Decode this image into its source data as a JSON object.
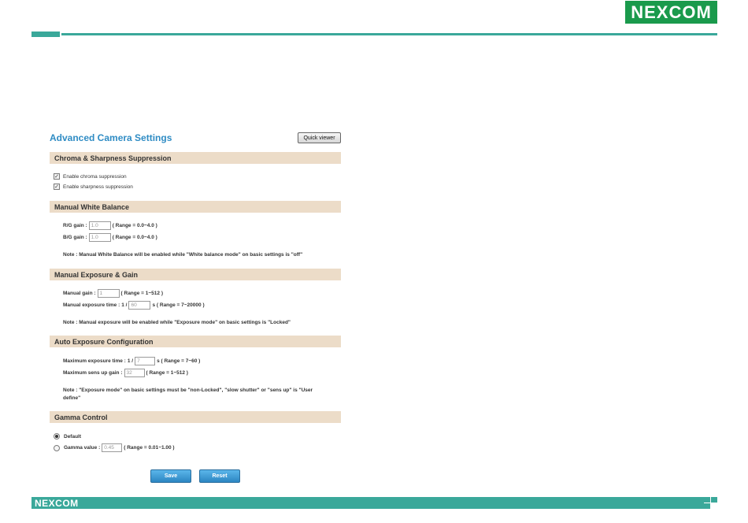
{
  "header": {
    "brand": "NEXCOM"
  },
  "page": {
    "title": "Advanced Camera Settings",
    "quick_viewer": "Quick viewer"
  },
  "chroma": {
    "title": "Chroma & Sharpness Suppression",
    "chroma_label": "Enable chroma suppression",
    "sharpness_label": "Enable sharpness suppression"
  },
  "wb": {
    "title": "Manual White Balance",
    "rg_label": "R/G gain :",
    "rg_value": "1.0",
    "rg_range": "( Range = 0.0~4.0 )",
    "bg_label": "B/G gain :",
    "bg_value": "1.0",
    "bg_range": "( Range = 0.0~4.0 )",
    "note": "Note : Manual White Balance will be enabled while \"White balance mode\" on basic settings is \"off\""
  },
  "exposure": {
    "title": "Manual Exposure & Gain",
    "gain_label": "Manual gain :",
    "gain_value": "1",
    "gain_range": "( Range = 1~512 )",
    "time_label": "Manual exposure time :",
    "time_prefix": "1 /",
    "time_value": "60",
    "time_range": "s ( Range = 7~20000 )",
    "note": "Note : Manual exposure will be enabled while \"Exposure mode\" on basic settings is \"Locked\""
  },
  "auto": {
    "title": "Auto Exposure Configuration",
    "max_time_label": "Maximum exposure time :",
    "max_time_prefix": "1 /",
    "max_time_value": "7",
    "max_time_range": "s ( Range = 7~60 )",
    "sens_label": "Maximum sens up gain :",
    "sens_value": "32",
    "sens_range": "( Range = 1~512 )",
    "note_line1": "Note : \"Exposure mode\" on basic settings must be \"non-Locked\", \"slow shutter\" or \"sens up\" is \"User",
    "note_line2": "define\""
  },
  "gamma": {
    "title": "Gamma Control",
    "default_label": "Default",
    "value_label": "Gamma value :",
    "value": "0.45",
    "range": "( Range = 0.01~1.00 )"
  },
  "actions": {
    "save": "Save",
    "reset": "Reset"
  },
  "footer": {
    "brand": "NEXCOM"
  }
}
